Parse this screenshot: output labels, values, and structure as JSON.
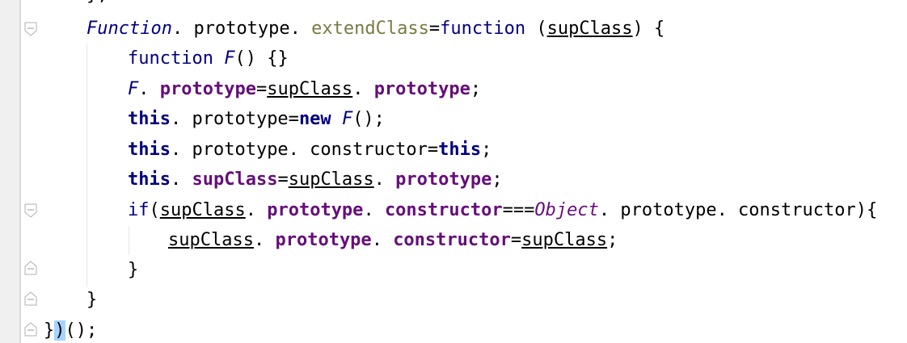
{
  "editor": {
    "colors": {
      "keyword": "#000080",
      "method": "#7a7a43",
      "field": "#660e7a",
      "gutter": "#f0f0f0",
      "bracket_highlight": "#a6d2ff"
    },
    "lines": [
      {
        "tokens": [
          {
            "t": "cls",
            "v": "Function"
          },
          {
            "t": "plain",
            "v": ". prototype. "
          },
          {
            "t": "method",
            "v": "extendClass"
          },
          {
            "t": "plain",
            "v": "="
          },
          {
            "t": "kw-normal",
            "v": "function"
          },
          {
            "t": "plain",
            "v": " ("
          },
          {
            "t": "param",
            "v": "supClass"
          },
          {
            "t": "plain",
            "v": ") {"
          }
        ]
      },
      {
        "tokens": [
          {
            "t": "kw-normal",
            "v": "function"
          },
          {
            "t": "plain",
            "v": " "
          },
          {
            "t": "cls",
            "v": "F"
          },
          {
            "t": "plain",
            "v": "() {}"
          }
        ]
      },
      {
        "tokens": [
          {
            "t": "cls",
            "v": "F"
          },
          {
            "t": "plain",
            "v": ". "
          },
          {
            "t": "field",
            "v": "prototype"
          },
          {
            "t": "plain",
            "v": "="
          },
          {
            "t": "param",
            "v": "supClass"
          },
          {
            "t": "plain",
            "v": ". "
          },
          {
            "t": "field",
            "v": "prototype"
          },
          {
            "t": "plain",
            "v": ";"
          }
        ]
      },
      {
        "tokens": [
          {
            "t": "kw",
            "v": "this"
          },
          {
            "t": "plain",
            "v": ". prototype="
          },
          {
            "t": "kw",
            "v": "new"
          },
          {
            "t": "plain",
            "v": " "
          },
          {
            "t": "cls",
            "v": "F"
          },
          {
            "t": "plain",
            "v": "();"
          }
        ]
      },
      {
        "tokens": [
          {
            "t": "kw",
            "v": "this"
          },
          {
            "t": "plain",
            "v": ". prototype. constructor="
          },
          {
            "t": "kw",
            "v": "this"
          },
          {
            "t": "plain",
            "v": ";"
          }
        ]
      },
      {
        "tokens": [
          {
            "t": "kw",
            "v": "this"
          },
          {
            "t": "plain",
            "v": ". "
          },
          {
            "t": "field",
            "v": "supClass"
          },
          {
            "t": "plain",
            "v": "="
          },
          {
            "t": "param",
            "v": "supClass"
          },
          {
            "t": "plain",
            "v": ". "
          },
          {
            "t": "field",
            "v": "prototype"
          },
          {
            "t": "plain",
            "v": ";"
          }
        ]
      },
      {
        "tokens": [
          {
            "t": "kw-normal",
            "v": "if"
          },
          {
            "t": "plain",
            "v": "("
          },
          {
            "t": "param",
            "v": "supClass"
          },
          {
            "t": "plain",
            "v": ". "
          },
          {
            "t": "field",
            "v": "prototype"
          },
          {
            "t": "plain",
            "v": ". "
          },
          {
            "t": "field",
            "v": "constructor"
          },
          {
            "t": "plain",
            "v": "==="
          },
          {
            "t": "obj",
            "v": "Object"
          },
          {
            "t": "plain",
            "v": ". prototype. constructor){"
          }
        ]
      },
      {
        "tokens": [
          {
            "t": "param",
            "v": "supClass"
          },
          {
            "t": "plain",
            "v": ". "
          },
          {
            "t": "field",
            "v": "prototype"
          },
          {
            "t": "plain",
            "v": ". "
          },
          {
            "t": "field",
            "v": "constructor"
          },
          {
            "t": "plain",
            "v": "="
          },
          {
            "t": "param",
            "v": "supClass"
          },
          {
            "t": "plain",
            "v": ";"
          }
        ]
      },
      {
        "tokens": [
          {
            "t": "plain",
            "v": "}"
          }
        ]
      },
      {
        "tokens": [
          {
            "t": "plain",
            "v": "}"
          }
        ]
      },
      {
        "tokens": [
          {
            "t": "plain",
            "v": "}"
          },
          {
            "t": "hl",
            "v": ")"
          },
          {
            "t": "plain",
            "v": "();"
          }
        ]
      }
    ]
  }
}
